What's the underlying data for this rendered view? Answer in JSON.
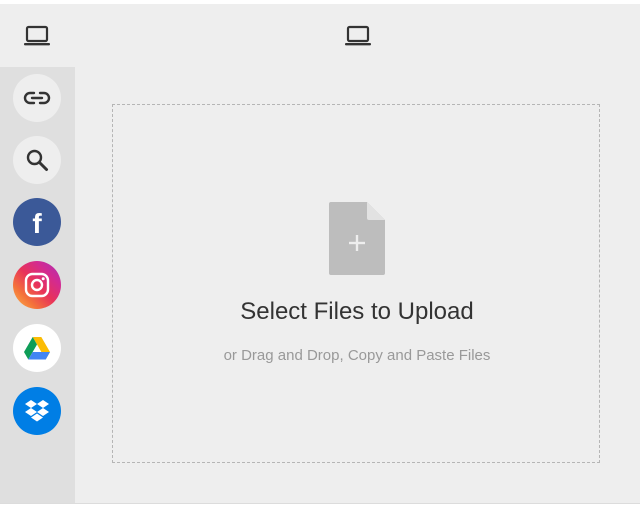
{
  "header": {
    "left_icon": "laptop-icon",
    "center_icon": "laptop-icon"
  },
  "sidebar": {
    "items": [
      {
        "name": "link",
        "icon": "link-icon",
        "background": "#eeeeee"
      },
      {
        "name": "search",
        "icon": "search-icon",
        "background": "#eeeeee"
      },
      {
        "name": "facebook",
        "icon": "facebook-icon",
        "background": "#3b5998",
        "glyph": "f"
      },
      {
        "name": "instagram",
        "icon": "instagram-icon",
        "background": "gradient"
      },
      {
        "name": "google-drive",
        "icon": "google-drive-icon",
        "background": "#ffffff"
      },
      {
        "name": "dropbox",
        "icon": "dropbox-icon",
        "background": "#007ee5"
      }
    ]
  },
  "dropzone": {
    "icon": "file-add-icon",
    "title": "Select Files to Upload",
    "subtitle": "or Drag and Drop, Copy and Paste Files"
  },
  "colors": {
    "background": "#eeeeee",
    "sidebar": "#dfdfdf",
    "title_text": "#333333",
    "subtitle_text": "#999999",
    "file_icon": "#bdbdbd"
  }
}
